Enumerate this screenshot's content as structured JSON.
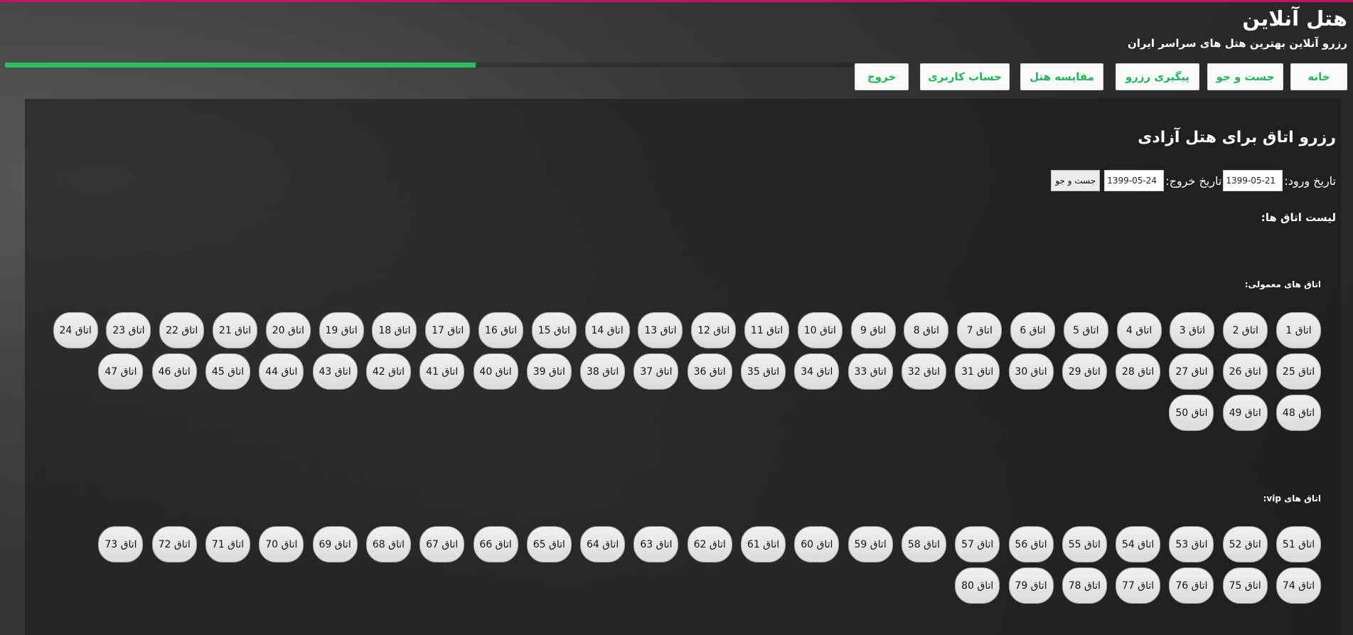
{
  "header": {
    "title": "هتل آنلاین",
    "subtitle": "رزرو آنلاین بهترین هتل های سراسر ایران",
    "progress": 0.54,
    "accent_color": "#27c25b",
    "top_border_color": "#c2185b"
  },
  "nav": [
    {
      "label": "خانه"
    },
    {
      "label": "جست و جو"
    },
    {
      "label": "پیگیری رزرو"
    },
    {
      "label": "مقایسه هتل"
    },
    {
      "label": "حساب کاربری"
    },
    {
      "label": "خروج"
    }
  ],
  "main": {
    "title": "رزرو اتاق برای هتل آزادی",
    "checkin_label": "تاریخ ورود:",
    "checkin_value": "1399-05-21",
    "checkout_label": "تاریخ خروج:",
    "checkout_value": "1399-05-24",
    "search_label": "جست و جو",
    "rooms_heading": "لیست اتاق ها:",
    "normal_label": "اتاق های معمولی:",
    "vip_label": "اتاق های vip:"
  },
  "normal_rooms": [
    "اتاق 1",
    "اتاق 2",
    "اتاق 3",
    "اتاق 4",
    "اتاق 5",
    "اتاق 6",
    "اتاق 7",
    "اتاق 8",
    "اتاق 9",
    "اتاق 10",
    "اتاق 11",
    "اتاق 12",
    "اتاق 13",
    "اتاق 14",
    "اتاق 15",
    "اتاق 16",
    "اتاق 17",
    "اتاق 18",
    "اتاق 19",
    "اتاق 20",
    "اتاق 21",
    "اتاق 22",
    "اتاق 23",
    "اتاق 24",
    "اتاق 25",
    "اتاق 26",
    "اتاق 27",
    "اتاق 28",
    "اتاق 29",
    "اتاق 30",
    "اتاق 31",
    "اتاق 32",
    "اتاق 33",
    "اتاق 34",
    "اتاق 35",
    "اتاق 36",
    "اتاق 37",
    "اتاق 38",
    "اتاق 39",
    "اتاق 40",
    "اتاق 41",
    "اتاق 42",
    "اتاق 43",
    "اتاق 44",
    "اتاق 45",
    "اتاق 46",
    "اتاق 47",
    "اتاق 48",
    "اتاق 49",
    "اتاق 50"
  ],
  "vip_rooms": [
    "اتاق 51",
    "اتاق 52",
    "اتاق 53",
    "اتاق 54",
    "اتاق 55",
    "اتاق 56",
    "اتاق 57",
    "اتاق 58",
    "اتاق 59",
    "اتاق 60",
    "اتاق 61",
    "اتاق 62",
    "اتاق 63",
    "اتاق 64",
    "اتاق 65",
    "اتاق 66",
    "اتاق 67",
    "اتاق 68",
    "اتاق 69",
    "اتاق 70",
    "اتاق 71",
    "اتاق 72",
    "اتاق 73",
    "اتاق 74",
    "اتاق 75",
    "اتاق 76",
    "اتاق 77",
    "اتاق 78",
    "اتاق 79",
    "اتاق 80"
  ]
}
